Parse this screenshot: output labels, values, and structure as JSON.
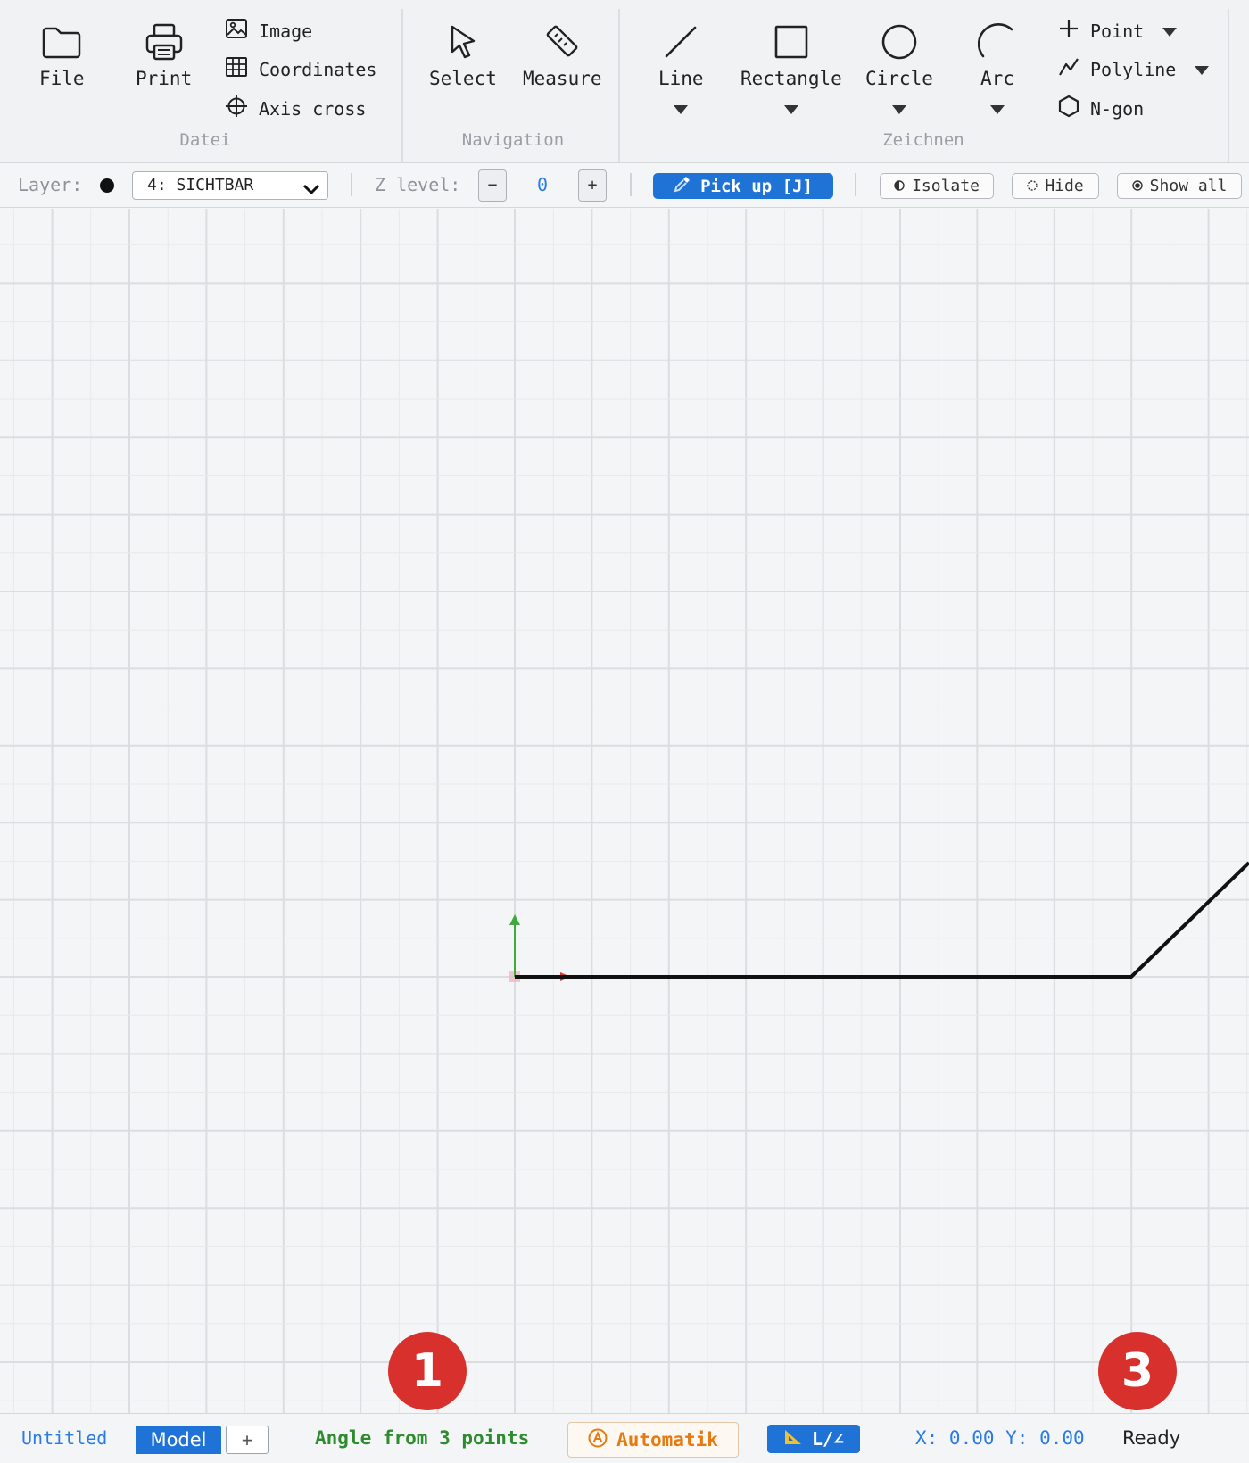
{
  "ribbon": {
    "groups": {
      "datei": "Datei",
      "navigation": "Navigation",
      "zeichnen": "Zeichnen"
    },
    "file": "File",
    "print": "Print",
    "image": "Image",
    "coordinates": "Coordinates",
    "axis_cross": "Axis cross",
    "select": "Select",
    "measure": "Measure",
    "line": "Line",
    "rectangle": "Rectangle",
    "circle": "Circle",
    "arc": "Arc",
    "point": "Point",
    "polyline": "Polyline",
    "ngon": "N-gon"
  },
  "layerbar": {
    "layer_label": "Layer:",
    "layer_value": "4: SICHTBAR",
    "z_label": "Z level:",
    "z_minus": "−",
    "z_value": "0",
    "z_plus": "+",
    "pickup": "Pick up [J]",
    "isolate": "Isolate",
    "hide": "Hide",
    "show_all": "Show all"
  },
  "statusbar": {
    "doc_tab": "Untitled",
    "model_tab": "Model",
    "add_tab": "+",
    "mode": "Angle from 3 points",
    "snap": "Automatik",
    "ortho": "L/∠",
    "coords": "X: 0.00 Y: 0.00",
    "state": "Ready"
  },
  "badges": [
    "1",
    "3"
  ],
  "colors": {
    "accent": "#1f73d6",
    "mode_text": "#2e8b2e",
    "snap_text": "#e67a10",
    "coords_text": "#2a7be4",
    "badge": "#d8312d",
    "grid_major": "#dcdde0",
    "grid_minor": "#e8e9eb"
  }
}
